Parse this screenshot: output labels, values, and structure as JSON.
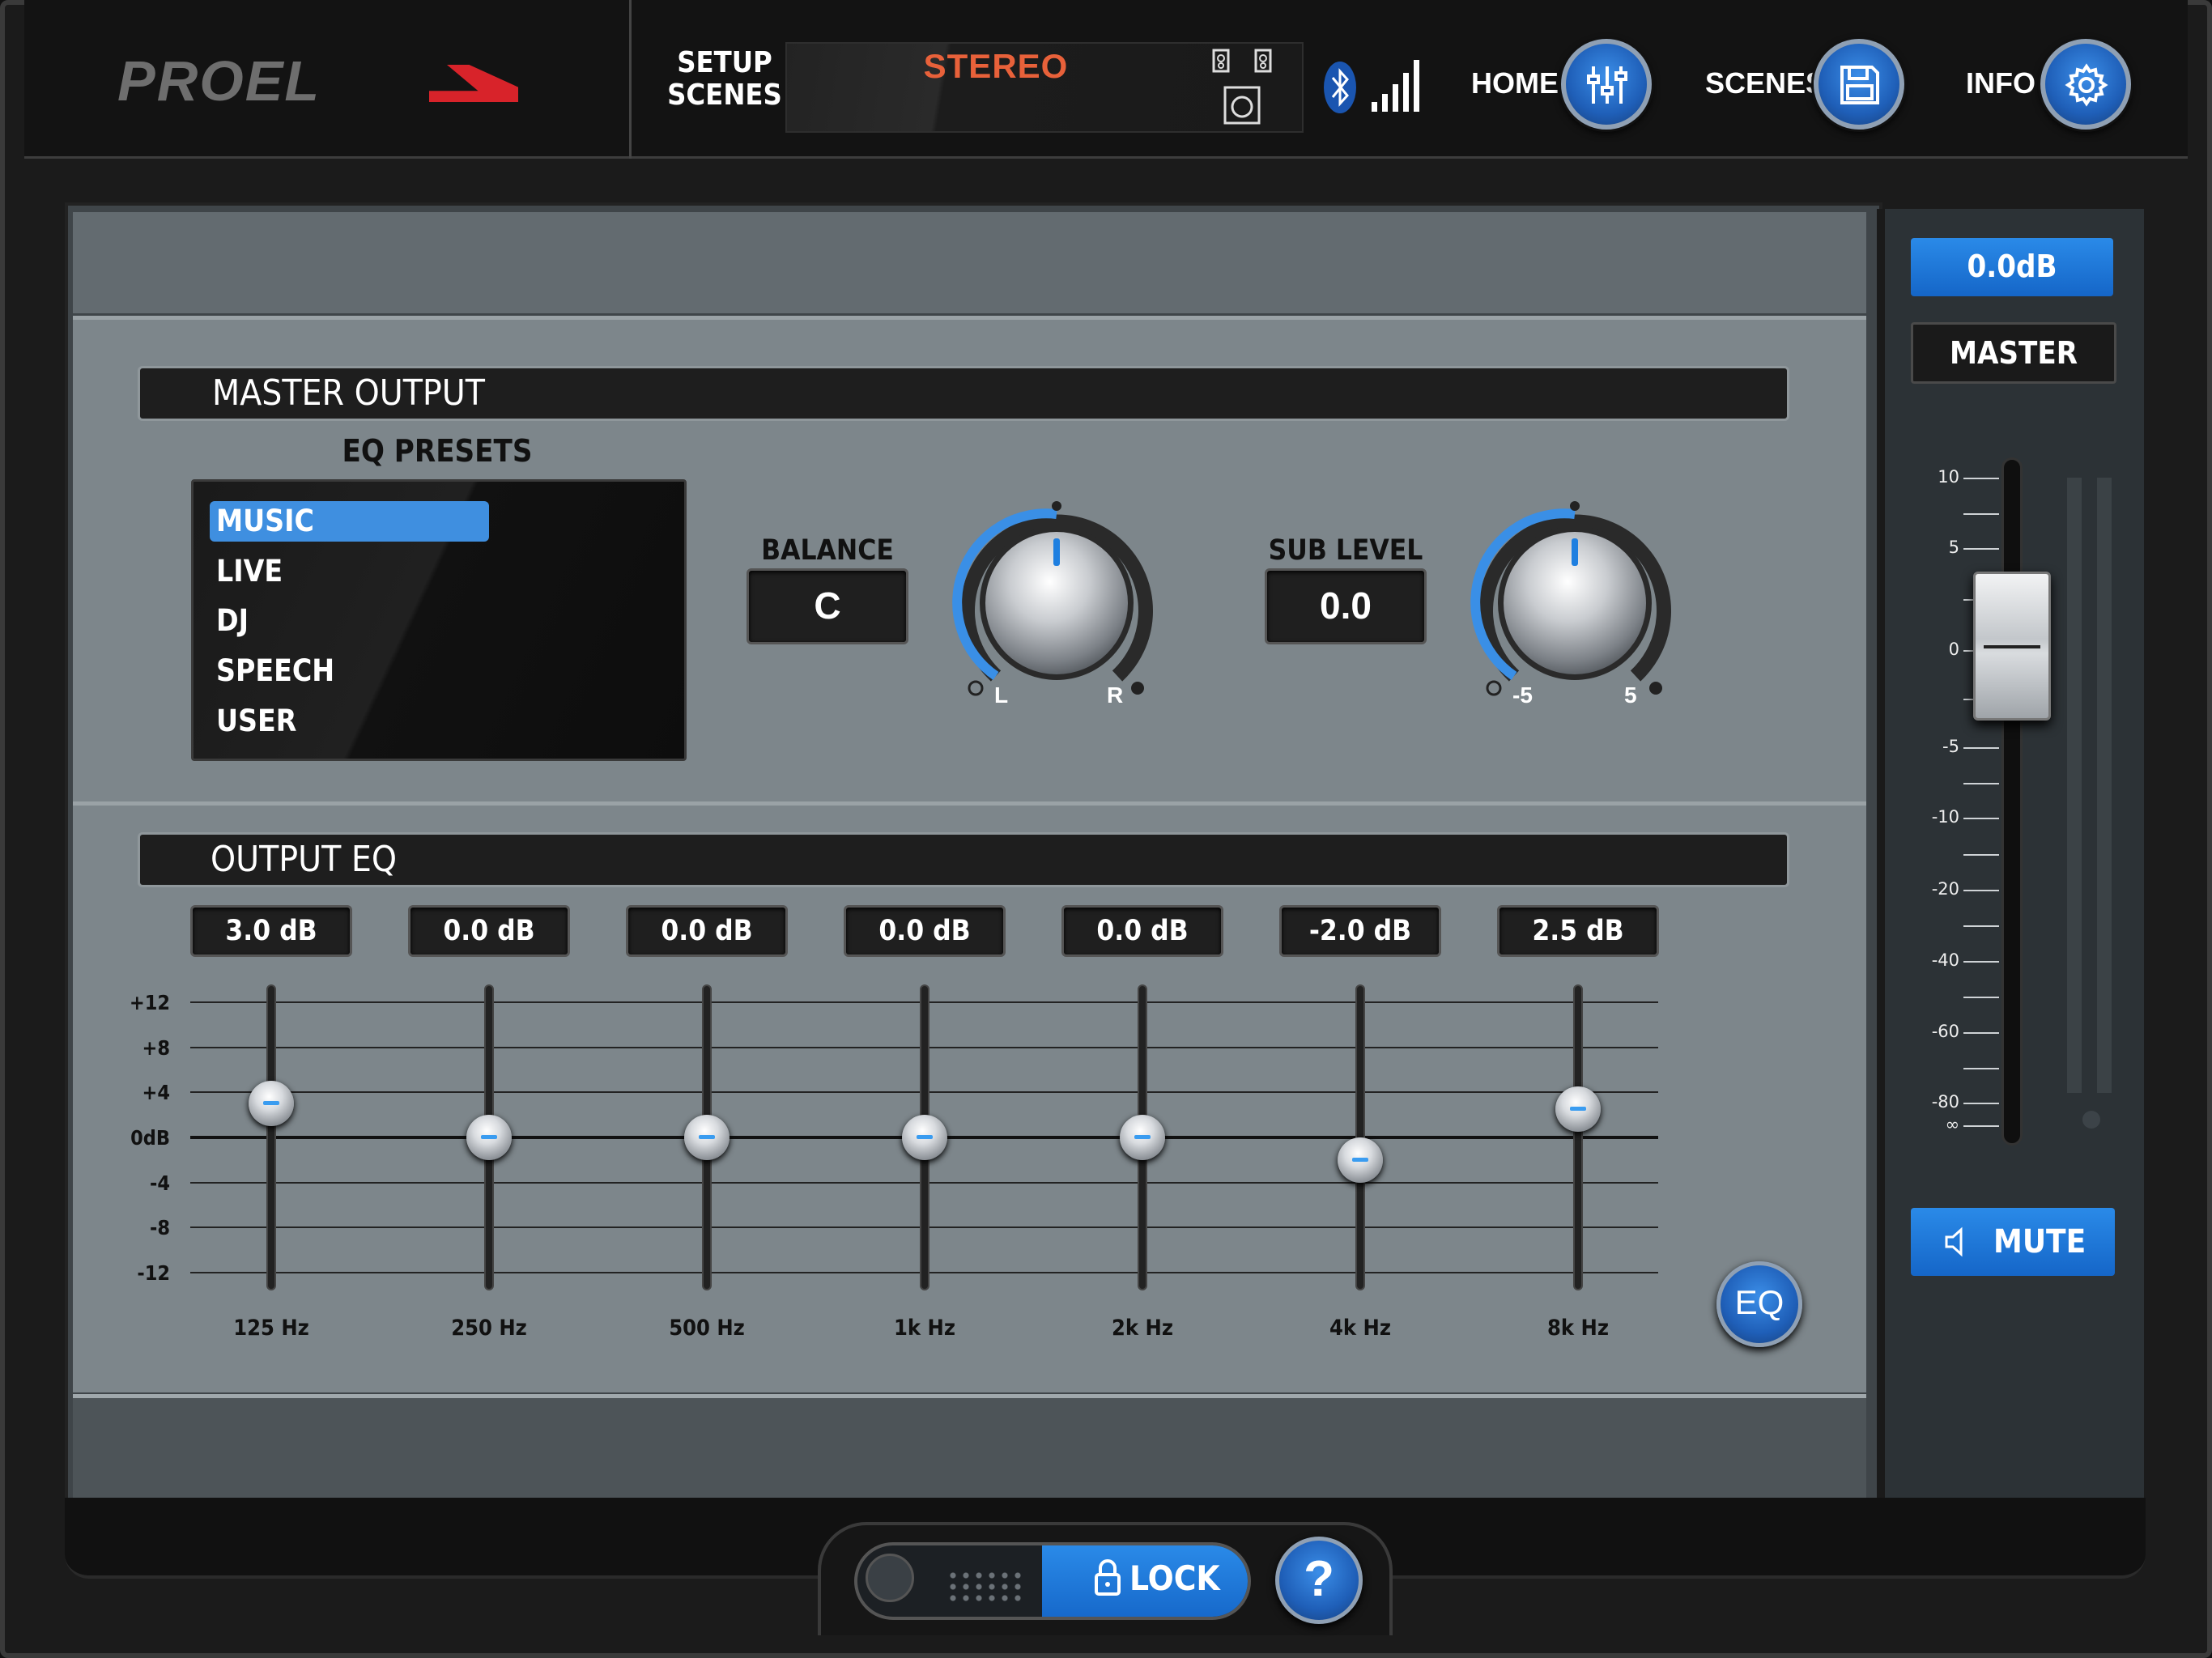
{
  "brand": {
    "name": "PROEL"
  },
  "header": {
    "setup_scenes_line1": "SETUP",
    "setup_scenes_line2": "SCENES",
    "mode": "STEREO",
    "mode_color": "#e8613a",
    "nav": [
      {
        "label": "HOME",
        "icon": "mixer-sliders-icon"
      },
      {
        "label": "SCENES",
        "icon": "save-icon"
      },
      {
        "label": "INFO",
        "icon": "gear-icon"
      }
    ]
  },
  "master_output": {
    "title": "MASTER OUTPUT",
    "eq_presets_title": "EQ PRESETS",
    "presets": [
      "MUSIC",
      "LIVE",
      "DJ",
      "SPEECH",
      "USER"
    ],
    "selected_preset": "MUSIC",
    "balance": {
      "label": "BALANCE",
      "value": "C",
      "min_label": "L",
      "max_label": "R"
    },
    "sub_level": {
      "label": "SUB LEVEL",
      "value": "0.0",
      "min_label": "-5",
      "max_label": "5"
    }
  },
  "output_eq": {
    "title": "OUTPUT EQ",
    "db_scale": [
      "+12",
      "+8",
      "+4",
      "0dB",
      "-4",
      "-8",
      "-12"
    ],
    "bands": [
      {
        "freq": "125 Hz",
        "value_label": "3.0 dB",
        "gain": 3.0
      },
      {
        "freq": "250 Hz",
        "value_label": "0.0 dB",
        "gain": 0.0
      },
      {
        "freq": "500 Hz",
        "value_label": "0.0 dB",
        "gain": 0.0
      },
      {
        "freq": "1k Hz",
        "value_label": "0.0 dB",
        "gain": 0.0
      },
      {
        "freq": "2k Hz",
        "value_label": "0.0 dB",
        "gain": 0.0
      },
      {
        "freq": "4k Hz",
        "value_label": "-2.0 dB",
        "gain": -2.0
      },
      {
        "freq": "8k Hz",
        "value_label": "2.5 dB",
        "gain": 2.5
      }
    ],
    "toggle_label": "EQ"
  },
  "master_strip": {
    "level": "0.0dB",
    "label": "MASTER",
    "scale": [
      "10",
      "5",
      "0",
      "-5",
      "-10",
      "-20",
      "-40",
      "-60",
      "-80",
      "∞"
    ],
    "mute_label": "MUTE"
  },
  "footer": {
    "lock_label": "LOCK",
    "help_label": "?"
  },
  "colors": {
    "accent": "#2a8ae8",
    "brand_red": "#d8232a",
    "panel": "#7d868b"
  }
}
